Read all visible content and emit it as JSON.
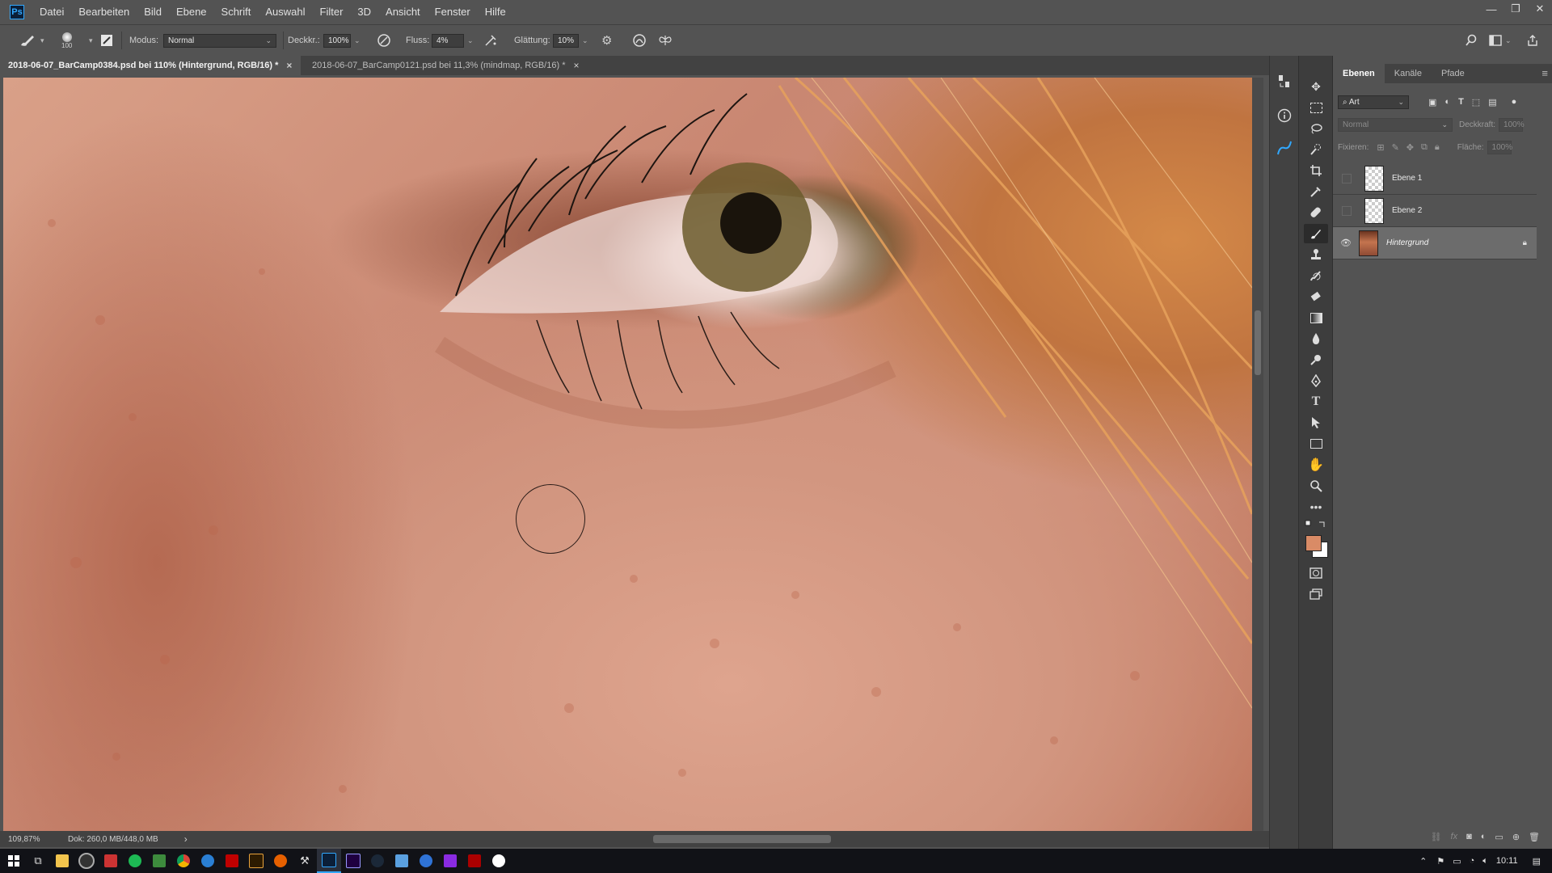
{
  "app": {
    "logo": "Ps"
  },
  "menu": [
    "Datei",
    "Bearbeiten",
    "Bild",
    "Ebene",
    "Schrift",
    "Auswahl",
    "Filter",
    "3D",
    "Ansicht",
    "Fenster",
    "Hilfe"
  ],
  "window_controls": {
    "minimize": "—",
    "restore": "❐",
    "close": "✕"
  },
  "options": {
    "brush_size": "100",
    "modus_label": "Modus:",
    "modus_value": "Normal",
    "deckkraft_label": "Deckkr.:",
    "deckkraft_value": "100%",
    "fluss_label": "Fluss:",
    "fluss_value": "4%",
    "glaettung_label": "Glättung:",
    "glaettung_value": "10%"
  },
  "tabs": [
    {
      "label": "2018-06-07_BarCamp0384.psd bei 110% (Hintergrund, RGB/16) *",
      "close": "×"
    },
    {
      "label": "2018-06-07_BarCamp0121.psd bei 11,3% (mindmap, RGB/16) *",
      "close": "×"
    }
  ],
  "status": {
    "zoom": "109,87%",
    "doc": "Dok: 260,0 MB/448,0 MB",
    "arrow": "›"
  },
  "panel": {
    "tabs": [
      "Ebenen",
      "Kanäle",
      "Pfade"
    ],
    "filter_label": "Art",
    "blend_mode": "Normal",
    "opacity_label": "Deckkraft:",
    "opacity_value": "100%",
    "lock_label": "Fixieren:",
    "fill_label": "Fläche:",
    "fill_value": "100%",
    "layers": [
      {
        "name": "Ebene 1",
        "visible": false
      },
      {
        "name": "Ebene 2",
        "visible": false
      },
      {
        "name": "Hintergrund",
        "visible": true
      }
    ]
  },
  "colors": {
    "foreground": "#d98b66",
    "background": "#ffffff",
    "accent": "#31a8ff"
  },
  "taskbar": {
    "time": "10:11"
  }
}
